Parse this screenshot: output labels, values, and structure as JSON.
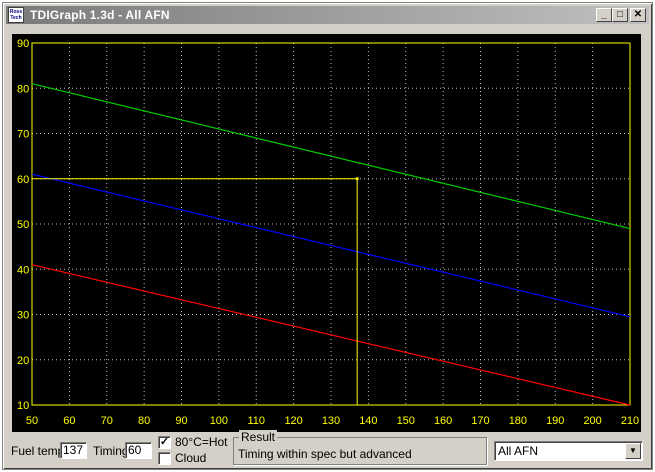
{
  "window": {
    "icon_text": "Ross Tech",
    "title": "TDIGraph 1.3d - All AFN",
    "minimize": "_",
    "maximize": "□",
    "close": "✕"
  },
  "chart_data": {
    "type": "line",
    "x_ticks": [
      50,
      60,
      70,
      80,
      90,
      100,
      110,
      120,
      130,
      140,
      150,
      160,
      170,
      180,
      190,
      200,
      210
    ],
    "y_ticks": [
      10,
      20,
      30,
      40,
      50,
      60,
      70,
      80,
      90
    ],
    "xlim": [
      50,
      210
    ],
    "ylim": [
      10,
      90
    ],
    "grid": true,
    "colors": {
      "background": "#000000",
      "axis": "#ffff00",
      "tick_text": "#ffff00",
      "grid": "#c0c0c0"
    },
    "series": [
      {
        "color": "#00cc00",
        "x": [
          50,
          210
        ],
        "y": [
          81,
          49
        ]
      },
      {
        "color": "#0000ff",
        "x": [
          50,
          210
        ],
        "y": [
          61,
          29.5
        ]
      },
      {
        "color": "#ff0000",
        "x": [
          50,
          210
        ],
        "y": [
          41,
          10
        ]
      }
    ],
    "marker": {
      "x": 137,
      "y": 60,
      "color": "#ffff00"
    }
  },
  "controls": {
    "fuel_temp_label": "Fuel temp",
    "fuel_temp_value": "137",
    "timing_label": "Timing",
    "timing_value": "60",
    "hot_checkbox_label": "80°C=Hot",
    "hot_checked": true,
    "cloud_checkbox_label": "Cloud",
    "cloud_checked": false,
    "result_label": "Result",
    "result_text": "Timing within spec but advanced",
    "model_select_value": "All AFN",
    "dropdown_icon": "▼"
  }
}
